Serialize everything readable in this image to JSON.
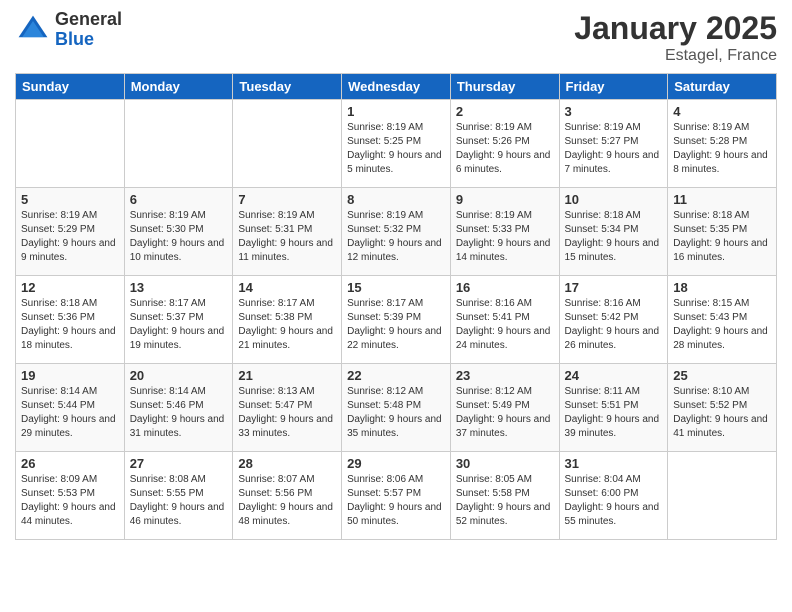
{
  "logo": {
    "general": "General",
    "blue": "Blue"
  },
  "header": {
    "month": "January 2025",
    "location": "Estagel, France"
  },
  "weekdays": [
    "Sunday",
    "Monday",
    "Tuesday",
    "Wednesday",
    "Thursday",
    "Friday",
    "Saturday"
  ],
  "weeks": [
    [
      {
        "day": "",
        "info": ""
      },
      {
        "day": "",
        "info": ""
      },
      {
        "day": "",
        "info": ""
      },
      {
        "day": "1",
        "info": "Sunrise: 8:19 AM\nSunset: 5:25 PM\nDaylight: 9 hours\nand 5 minutes."
      },
      {
        "day": "2",
        "info": "Sunrise: 8:19 AM\nSunset: 5:26 PM\nDaylight: 9 hours\nand 6 minutes."
      },
      {
        "day": "3",
        "info": "Sunrise: 8:19 AM\nSunset: 5:27 PM\nDaylight: 9 hours\nand 7 minutes."
      },
      {
        "day": "4",
        "info": "Sunrise: 8:19 AM\nSunset: 5:28 PM\nDaylight: 9 hours\nand 8 minutes."
      }
    ],
    [
      {
        "day": "5",
        "info": "Sunrise: 8:19 AM\nSunset: 5:29 PM\nDaylight: 9 hours\nand 9 minutes."
      },
      {
        "day": "6",
        "info": "Sunrise: 8:19 AM\nSunset: 5:30 PM\nDaylight: 9 hours\nand 10 minutes."
      },
      {
        "day": "7",
        "info": "Sunrise: 8:19 AM\nSunset: 5:31 PM\nDaylight: 9 hours\nand 11 minutes."
      },
      {
        "day": "8",
        "info": "Sunrise: 8:19 AM\nSunset: 5:32 PM\nDaylight: 9 hours\nand 12 minutes."
      },
      {
        "day": "9",
        "info": "Sunrise: 8:19 AM\nSunset: 5:33 PM\nDaylight: 9 hours\nand 14 minutes."
      },
      {
        "day": "10",
        "info": "Sunrise: 8:18 AM\nSunset: 5:34 PM\nDaylight: 9 hours\nand 15 minutes."
      },
      {
        "day": "11",
        "info": "Sunrise: 8:18 AM\nSunset: 5:35 PM\nDaylight: 9 hours\nand 16 minutes."
      }
    ],
    [
      {
        "day": "12",
        "info": "Sunrise: 8:18 AM\nSunset: 5:36 PM\nDaylight: 9 hours\nand 18 minutes."
      },
      {
        "day": "13",
        "info": "Sunrise: 8:17 AM\nSunset: 5:37 PM\nDaylight: 9 hours\nand 19 minutes."
      },
      {
        "day": "14",
        "info": "Sunrise: 8:17 AM\nSunset: 5:38 PM\nDaylight: 9 hours\nand 21 minutes."
      },
      {
        "day": "15",
        "info": "Sunrise: 8:17 AM\nSunset: 5:39 PM\nDaylight: 9 hours\nand 22 minutes."
      },
      {
        "day": "16",
        "info": "Sunrise: 8:16 AM\nSunset: 5:41 PM\nDaylight: 9 hours\nand 24 minutes."
      },
      {
        "day": "17",
        "info": "Sunrise: 8:16 AM\nSunset: 5:42 PM\nDaylight: 9 hours\nand 26 minutes."
      },
      {
        "day": "18",
        "info": "Sunrise: 8:15 AM\nSunset: 5:43 PM\nDaylight: 9 hours\nand 28 minutes."
      }
    ],
    [
      {
        "day": "19",
        "info": "Sunrise: 8:14 AM\nSunset: 5:44 PM\nDaylight: 9 hours\nand 29 minutes."
      },
      {
        "day": "20",
        "info": "Sunrise: 8:14 AM\nSunset: 5:46 PM\nDaylight: 9 hours\nand 31 minutes."
      },
      {
        "day": "21",
        "info": "Sunrise: 8:13 AM\nSunset: 5:47 PM\nDaylight: 9 hours\nand 33 minutes."
      },
      {
        "day": "22",
        "info": "Sunrise: 8:12 AM\nSunset: 5:48 PM\nDaylight: 9 hours\nand 35 minutes."
      },
      {
        "day": "23",
        "info": "Sunrise: 8:12 AM\nSunset: 5:49 PM\nDaylight: 9 hours\nand 37 minutes."
      },
      {
        "day": "24",
        "info": "Sunrise: 8:11 AM\nSunset: 5:51 PM\nDaylight: 9 hours\nand 39 minutes."
      },
      {
        "day": "25",
        "info": "Sunrise: 8:10 AM\nSunset: 5:52 PM\nDaylight: 9 hours\nand 41 minutes."
      }
    ],
    [
      {
        "day": "26",
        "info": "Sunrise: 8:09 AM\nSunset: 5:53 PM\nDaylight: 9 hours\nand 44 minutes."
      },
      {
        "day": "27",
        "info": "Sunrise: 8:08 AM\nSunset: 5:55 PM\nDaylight: 9 hours\nand 46 minutes."
      },
      {
        "day": "28",
        "info": "Sunrise: 8:07 AM\nSunset: 5:56 PM\nDaylight: 9 hours\nand 48 minutes."
      },
      {
        "day": "29",
        "info": "Sunrise: 8:06 AM\nSunset: 5:57 PM\nDaylight: 9 hours\nand 50 minutes."
      },
      {
        "day": "30",
        "info": "Sunrise: 8:05 AM\nSunset: 5:58 PM\nDaylight: 9 hours\nand 52 minutes."
      },
      {
        "day": "31",
        "info": "Sunrise: 8:04 AM\nSunset: 6:00 PM\nDaylight: 9 hours\nand 55 minutes."
      },
      {
        "day": "",
        "info": ""
      }
    ]
  ]
}
